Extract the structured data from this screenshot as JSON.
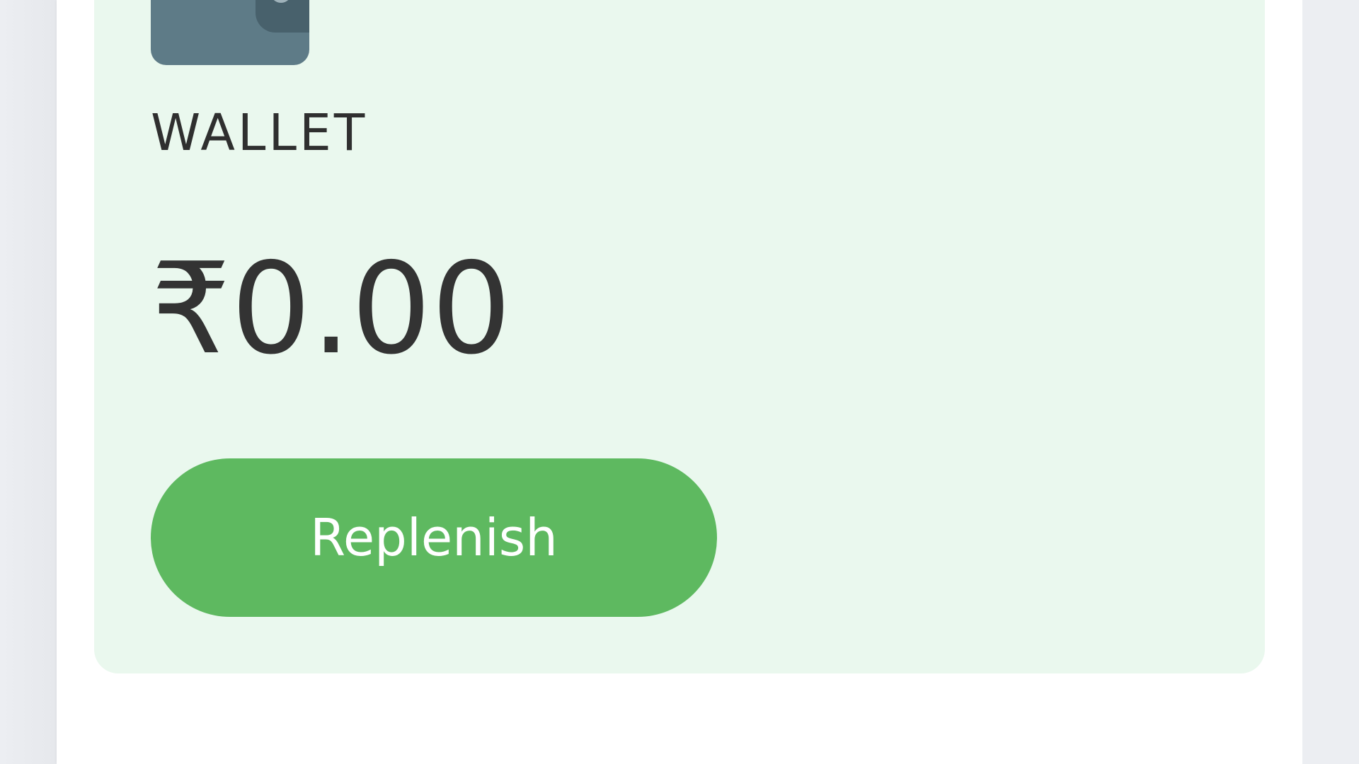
{
  "wallet": {
    "icon": "wallet-icon",
    "label": "WALLET",
    "balance": "₹0.00",
    "replenish_label": "Replenish"
  },
  "colors": {
    "card_background": "#eaf8ee",
    "button_green": "#5eb960",
    "icon_slate": "#5e7b87"
  }
}
